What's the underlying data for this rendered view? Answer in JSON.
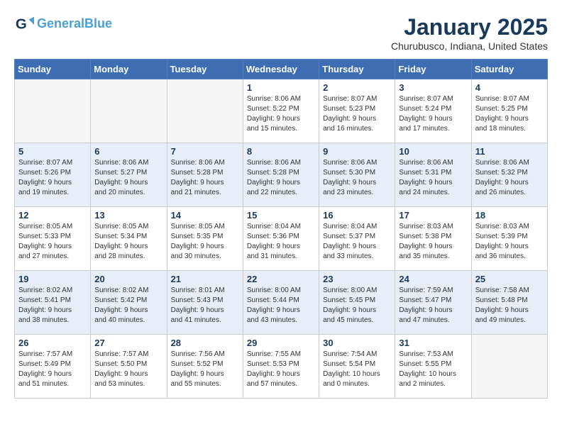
{
  "header": {
    "logo_line1": "General",
    "logo_line2": "Blue",
    "title": "January 2025",
    "subtitle": "Churubusco, Indiana, United States"
  },
  "weekdays": [
    "Sunday",
    "Monday",
    "Tuesday",
    "Wednesday",
    "Thursday",
    "Friday",
    "Saturday"
  ],
  "weeks": [
    [
      {
        "day": "",
        "info": ""
      },
      {
        "day": "",
        "info": ""
      },
      {
        "day": "",
        "info": ""
      },
      {
        "day": "1",
        "info": "Sunrise: 8:06 AM\nSunset: 5:22 PM\nDaylight: 9 hours\nand 15 minutes."
      },
      {
        "day": "2",
        "info": "Sunrise: 8:07 AM\nSunset: 5:23 PM\nDaylight: 9 hours\nand 16 minutes."
      },
      {
        "day": "3",
        "info": "Sunrise: 8:07 AM\nSunset: 5:24 PM\nDaylight: 9 hours\nand 17 minutes."
      },
      {
        "day": "4",
        "info": "Sunrise: 8:07 AM\nSunset: 5:25 PM\nDaylight: 9 hours\nand 18 minutes."
      }
    ],
    [
      {
        "day": "5",
        "info": "Sunrise: 8:07 AM\nSunset: 5:26 PM\nDaylight: 9 hours\nand 19 minutes."
      },
      {
        "day": "6",
        "info": "Sunrise: 8:06 AM\nSunset: 5:27 PM\nDaylight: 9 hours\nand 20 minutes."
      },
      {
        "day": "7",
        "info": "Sunrise: 8:06 AM\nSunset: 5:28 PM\nDaylight: 9 hours\nand 21 minutes."
      },
      {
        "day": "8",
        "info": "Sunrise: 8:06 AM\nSunset: 5:28 PM\nDaylight: 9 hours\nand 22 minutes."
      },
      {
        "day": "9",
        "info": "Sunrise: 8:06 AM\nSunset: 5:30 PM\nDaylight: 9 hours\nand 23 minutes."
      },
      {
        "day": "10",
        "info": "Sunrise: 8:06 AM\nSunset: 5:31 PM\nDaylight: 9 hours\nand 24 minutes."
      },
      {
        "day": "11",
        "info": "Sunrise: 8:06 AM\nSunset: 5:32 PM\nDaylight: 9 hours\nand 26 minutes."
      }
    ],
    [
      {
        "day": "12",
        "info": "Sunrise: 8:05 AM\nSunset: 5:33 PM\nDaylight: 9 hours\nand 27 minutes."
      },
      {
        "day": "13",
        "info": "Sunrise: 8:05 AM\nSunset: 5:34 PM\nDaylight: 9 hours\nand 28 minutes."
      },
      {
        "day": "14",
        "info": "Sunrise: 8:05 AM\nSunset: 5:35 PM\nDaylight: 9 hours\nand 30 minutes."
      },
      {
        "day": "15",
        "info": "Sunrise: 8:04 AM\nSunset: 5:36 PM\nDaylight: 9 hours\nand 31 minutes."
      },
      {
        "day": "16",
        "info": "Sunrise: 8:04 AM\nSunset: 5:37 PM\nDaylight: 9 hours\nand 33 minutes."
      },
      {
        "day": "17",
        "info": "Sunrise: 8:03 AM\nSunset: 5:38 PM\nDaylight: 9 hours\nand 35 minutes."
      },
      {
        "day": "18",
        "info": "Sunrise: 8:03 AM\nSunset: 5:39 PM\nDaylight: 9 hours\nand 36 minutes."
      }
    ],
    [
      {
        "day": "19",
        "info": "Sunrise: 8:02 AM\nSunset: 5:41 PM\nDaylight: 9 hours\nand 38 minutes."
      },
      {
        "day": "20",
        "info": "Sunrise: 8:02 AM\nSunset: 5:42 PM\nDaylight: 9 hours\nand 40 minutes."
      },
      {
        "day": "21",
        "info": "Sunrise: 8:01 AM\nSunset: 5:43 PM\nDaylight: 9 hours\nand 41 minutes."
      },
      {
        "day": "22",
        "info": "Sunrise: 8:00 AM\nSunset: 5:44 PM\nDaylight: 9 hours\nand 43 minutes."
      },
      {
        "day": "23",
        "info": "Sunrise: 8:00 AM\nSunset: 5:45 PM\nDaylight: 9 hours\nand 45 minutes."
      },
      {
        "day": "24",
        "info": "Sunrise: 7:59 AM\nSunset: 5:47 PM\nDaylight: 9 hours\nand 47 minutes."
      },
      {
        "day": "25",
        "info": "Sunrise: 7:58 AM\nSunset: 5:48 PM\nDaylight: 9 hours\nand 49 minutes."
      }
    ],
    [
      {
        "day": "26",
        "info": "Sunrise: 7:57 AM\nSunset: 5:49 PM\nDaylight: 9 hours\nand 51 minutes."
      },
      {
        "day": "27",
        "info": "Sunrise: 7:57 AM\nSunset: 5:50 PM\nDaylight: 9 hours\nand 53 minutes."
      },
      {
        "day": "28",
        "info": "Sunrise: 7:56 AM\nSunset: 5:52 PM\nDaylight: 9 hours\nand 55 minutes."
      },
      {
        "day": "29",
        "info": "Sunrise: 7:55 AM\nSunset: 5:53 PM\nDaylight: 9 hours\nand 57 minutes."
      },
      {
        "day": "30",
        "info": "Sunrise: 7:54 AM\nSunset: 5:54 PM\nDaylight: 10 hours\nand 0 minutes."
      },
      {
        "day": "31",
        "info": "Sunrise: 7:53 AM\nSunset: 5:55 PM\nDaylight: 10 hours\nand 2 minutes."
      },
      {
        "day": "",
        "info": ""
      }
    ]
  ]
}
